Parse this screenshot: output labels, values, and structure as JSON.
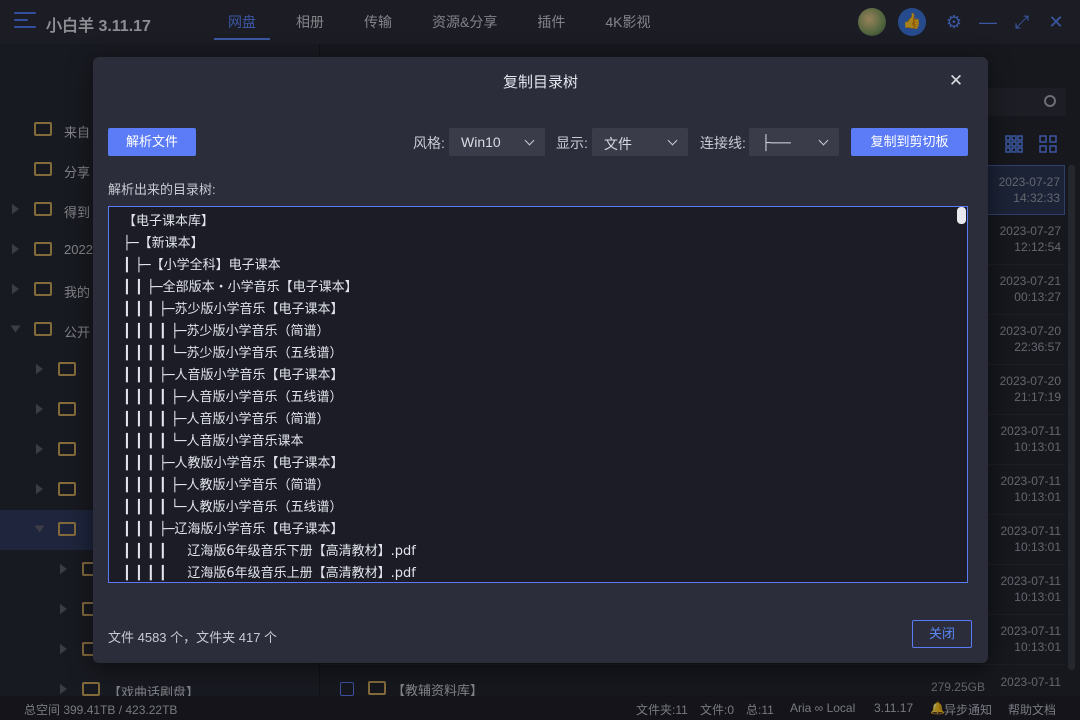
{
  "app": {
    "title": "小白羊 3.11.17",
    "nav": [
      "网盘",
      "相册",
      "传输",
      "资源&分享",
      "插件",
      "4K影视"
    ],
    "active_nav": "网盘",
    "accent_color": "#5b7cf6"
  },
  "sidebar": {
    "items": [
      "来自",
      "分享",
      "得到",
      "2022",
      "我的",
      "公开",
      "",
      "",
      "",
      "",
      "",
      "",
      "",
      "",
      "【戏曲话剧盘】"
    ]
  },
  "file_list": {
    "dates": [
      [
        "2023-07-27",
        "14:32:33"
      ],
      [
        "2023-07-27",
        "12:12:54"
      ],
      [
        "2023-07-21",
        "00:13:27"
      ],
      [
        "2023-07-20",
        "22:36:57"
      ],
      [
        "2023-07-20",
        "21:17:19"
      ],
      [
        "2023-07-11",
        "10:13:01"
      ],
      [
        "2023-07-11",
        "10:13:01"
      ],
      [
        "2023-07-11",
        "10:13:01"
      ],
      [
        "2023-07-11",
        "10:13:01"
      ],
      [
        "2023-07-11",
        "10:13:01"
      ],
      [
        "2023-07-11",
        ""
      ]
    ],
    "bottom_item": "【教辅资料库】",
    "bottom_size": "279.25GB"
  },
  "statusbar": {
    "space": "总空间 399.41TB / 423.22TB",
    "folders": "文件夹:11",
    "files": "文件:0",
    "total": "总:11",
    "aria": "Aria ∞ Local",
    "version": "3.11.17",
    "notify": "异步通知",
    "help": "帮助文档"
  },
  "dialog": {
    "title": "复制目录树",
    "parse_button": "解析文件",
    "style_label": "风格:",
    "style_value": "Win10",
    "show_label": "显示:",
    "show_value": "文件",
    "line_label": "连接线:",
    "line_value": "├──",
    "copy_button": "复制到剪切板",
    "tree_label": "解析出来的目录树:",
    "tree": [
      "【电子课本库】",
      "├─【新课本】",
      "┃ ├─【小学全科】电子课本",
      "┃ ┃ ├─全部版本・小学音乐【电子课本】",
      "┃ ┃ ┃ ├─苏少版小学音乐【电子课本】",
      "┃ ┃ ┃ ┃ ├─苏少版小学音乐（简谱）",
      "┃ ┃ ┃ ┃ └─苏少版小学音乐（五线谱）",
      "┃ ┃ ┃ ├─人音版小学音乐【电子课本】",
      "┃ ┃ ┃ ┃ ├─人音版小学音乐（五线谱）",
      "┃ ┃ ┃ ┃ ├─人音版小学音乐（简谱）",
      "┃ ┃ ┃ ┃ └─人音版小学音乐课本",
      "┃ ┃ ┃ ├─人教版小学音乐【电子课本】",
      "┃ ┃ ┃ ┃ ├─人教版小学音乐（简谱）",
      "┃ ┃ ┃ ┃ └─人教版小学音乐（五线谱）",
      "┃ ┃ ┃ ├─辽海版小学音乐【电子课本】",
      "┃ ┃ ┃ ┃     辽海版6年级音乐下册【高清教材】.pdf",
      "┃ ┃ ┃ ┃     辽海版6年级音乐上册【高清教材】.pdf"
    ],
    "summary": "文件 4583 个，文件夹 417 个",
    "close_button": "关闭"
  }
}
